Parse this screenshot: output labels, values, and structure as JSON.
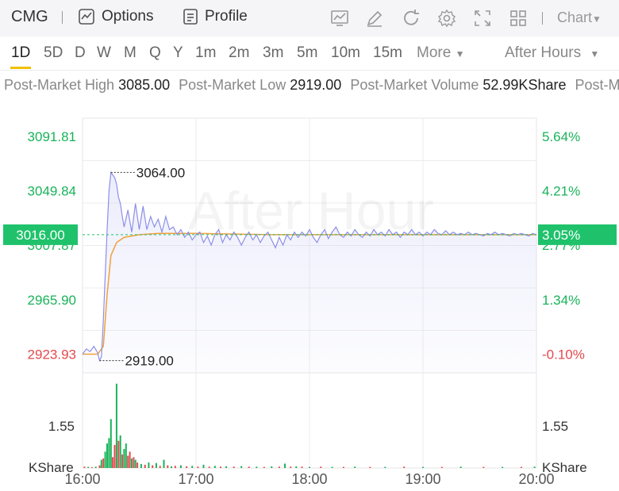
{
  "header": {
    "symbol": "CMG",
    "options_label": "Options",
    "profile_label": "Profile",
    "chart_label": "Chart"
  },
  "periods": [
    "1D",
    "5D",
    "D",
    "W",
    "M",
    "Q",
    "Y",
    "1m",
    "2m",
    "3m",
    "5m",
    "10m",
    "15m"
  ],
  "active_period": "1D",
  "more_label": "More",
  "session_label": "After Hours",
  "stats": [
    {
      "label": "Post-Market High",
      "value": "3085.00"
    },
    {
      "label": "Post-Market Low",
      "value": "2919.00"
    },
    {
      "label": "Post-Market Volume",
      "value": "52.99KShare"
    },
    {
      "label": "Post-Market Turnover",
      "value": ""
    }
  ],
  "colors": {
    "up": "#19b35a",
    "down": "#e5484d",
    "price_line": "#8c8fe8",
    "avg_line": "#f2a03c",
    "badge_bg": "#1fc26b"
  },
  "chart_data": {
    "type": "line",
    "watermark": "After Hour",
    "x_ticks": [
      "16:00",
      "17:00",
      "18:00",
      "19:00",
      "20:00"
    ],
    "x_range": [
      0,
      240
    ],
    "y_range": [
      2909.61,
      3105.78
    ],
    "y_ticks_left": [
      "3091.81",
      "3049.84",
      "3007.87",
      "2965.90",
      "2923.93"
    ],
    "y_ticks_right": [
      "5.64%",
      "4.21%",
      "2.77%",
      "1.34%",
      "-0.10%"
    ],
    "last_price": "3016.00",
    "last_price_pct": "3.05%",
    "max_label": "3064.00",
    "min_label": "2919.00",
    "max_point": {
      "t": 15,
      "v": 3064.0
    },
    "min_point": {
      "t": 9,
      "v": 2919.0
    },
    "price_series": [
      {
        "t": 0,
        "v": 2924
      },
      {
        "t": 2,
        "v": 2928
      },
      {
        "t": 4,
        "v": 2926
      },
      {
        "t": 6,
        "v": 2930
      },
      {
        "t": 8,
        "v": 2925
      },
      {
        "t": 9,
        "v": 2919
      },
      {
        "t": 10,
        "v": 2922
      },
      {
        "t": 11,
        "v": 2950
      },
      {
        "t": 12,
        "v": 2985
      },
      {
        "t": 13,
        "v": 3020
      },
      {
        "t": 14,
        "v": 3050
      },
      {
        "t": 15,
        "v": 3064
      },
      {
        "t": 16,
        "v": 3062
      },
      {
        "t": 17,
        "v": 3060
      },
      {
        "t": 18,
        "v": 3055
      },
      {
        "t": 19,
        "v": 3045
      },
      {
        "t": 20,
        "v": 3040
      },
      {
        "t": 21,
        "v": 3030
      },
      {
        "t": 22,
        "v": 3022
      },
      {
        "t": 24,
        "v": 3035
      },
      {
        "t": 26,
        "v": 3018
      },
      {
        "t": 28,
        "v": 3040
      },
      {
        "t": 30,
        "v": 3020
      },
      {
        "t": 32,
        "v": 3038
      },
      {
        "t": 34,
        "v": 3020
      },
      {
        "t": 36,
        "v": 3030
      },
      {
        "t": 38,
        "v": 3022
      },
      {
        "t": 40,
        "v": 3028
      },
      {
        "t": 42,
        "v": 3018
      },
      {
        "t": 44,
        "v": 3030
      },
      {
        "t": 46,
        "v": 3020
      },
      {
        "t": 48,
        "v": 3022
      },
      {
        "t": 50,
        "v": 3016
      },
      {
        "t": 52,
        "v": 3020
      },
      {
        "t": 54,
        "v": 3014
      },
      {
        "t": 56,
        "v": 3018
      },
      {
        "t": 58,
        "v": 3012
      },
      {
        "t": 60,
        "v": 3016
      },
      {
        "t": 62,
        "v": 3018
      },
      {
        "t": 64,
        "v": 3010
      },
      {
        "t": 66,
        "v": 3015
      },
      {
        "t": 68,
        "v": 3008
      },
      {
        "t": 70,
        "v": 3016
      },
      {
        "t": 72,
        "v": 3020
      },
      {
        "t": 74,
        "v": 3010
      },
      {
        "t": 76,
        "v": 3016
      },
      {
        "t": 78,
        "v": 3012
      },
      {
        "t": 80,
        "v": 3018
      },
      {
        "t": 82,
        "v": 3014
      },
      {
        "t": 84,
        "v": 3008
      },
      {
        "t": 86,
        "v": 3014
      },
      {
        "t": 88,
        "v": 3018
      },
      {
        "t": 90,
        "v": 3012
      },
      {
        "t": 92,
        "v": 3016
      },
      {
        "t": 94,
        "v": 3010
      },
      {
        "t": 96,
        "v": 3015
      },
      {
        "t": 98,
        "v": 3018
      },
      {
        "t": 100,
        "v": 3012
      },
      {
        "t": 102,
        "v": 3006
      },
      {
        "t": 104,
        "v": 3014
      },
      {
        "t": 106,
        "v": 3008
      },
      {
        "t": 108,
        "v": 3016
      },
      {
        "t": 110,
        "v": 3012
      },
      {
        "t": 112,
        "v": 3018
      },
      {
        "t": 114,
        "v": 3014
      },
      {
        "t": 116,
        "v": 3018
      },
      {
        "t": 118,
        "v": 3015
      },
      {
        "t": 120,
        "v": 3020
      },
      {
        "t": 122,
        "v": 3014
      },
      {
        "t": 124,
        "v": 3010
      },
      {
        "t": 126,
        "v": 3016
      },
      {
        "t": 128,
        "v": 3020
      },
      {
        "t": 130,
        "v": 3013
      },
      {
        "t": 132,
        "v": 3018
      },
      {
        "t": 134,
        "v": 3022
      },
      {
        "t": 136,
        "v": 3016
      },
      {
        "t": 138,
        "v": 3014
      },
      {
        "t": 140,
        "v": 3018
      },
      {
        "t": 142,
        "v": 3015
      },
      {
        "t": 144,
        "v": 3020
      },
      {
        "t": 146,
        "v": 3016
      },
      {
        "t": 148,
        "v": 3014
      },
      {
        "t": 150,
        "v": 3018
      },
      {
        "t": 152,
        "v": 3015
      },
      {
        "t": 154,
        "v": 3020
      },
      {
        "t": 156,
        "v": 3016
      },
      {
        "t": 158,
        "v": 3018
      },
      {
        "t": 160,
        "v": 3015
      },
      {
        "t": 162,
        "v": 3020
      },
      {
        "t": 164,
        "v": 3016
      },
      {
        "t": 166,
        "v": 3018
      },
      {
        "t": 168,
        "v": 3014
      },
      {
        "t": 170,
        "v": 3018
      },
      {
        "t": 172,
        "v": 3016
      },
      {
        "t": 174,
        "v": 3020
      },
      {
        "t": 176,
        "v": 3016
      },
      {
        "t": 178,
        "v": 3018
      },
      {
        "t": 180,
        "v": 3015
      },
      {
        "t": 182,
        "v": 3018
      },
      {
        "t": 184,
        "v": 3016
      },
      {
        "t": 186,
        "v": 3020
      },
      {
        "t": 188,
        "v": 3017
      },
      {
        "t": 190,
        "v": 3016
      },
      {
        "t": 192,
        "v": 3019
      },
      {
        "t": 194,
        "v": 3016
      },
      {
        "t": 196,
        "v": 3018
      },
      {
        "t": 198,
        "v": 3016
      },
      {
        "t": 200,
        "v": 3017
      },
      {
        "t": 202,
        "v": 3016
      },
      {
        "t": 204,
        "v": 3018
      },
      {
        "t": 206,
        "v": 3016
      },
      {
        "t": 208,
        "v": 3017
      },
      {
        "t": 210,
        "v": 3016
      },
      {
        "t": 212,
        "v": 3015
      },
      {
        "t": 214,
        "v": 3017
      },
      {
        "t": 216,
        "v": 3016
      },
      {
        "t": 218,
        "v": 3018
      },
      {
        "t": 220,
        "v": 3016
      },
      {
        "t": 222,
        "v": 3017
      },
      {
        "t": 224,
        "v": 3016
      },
      {
        "t": 226,
        "v": 3015
      },
      {
        "t": 228,
        "v": 3017
      },
      {
        "t": 230,
        "v": 3016
      },
      {
        "t": 232,
        "v": 3017
      },
      {
        "t": 234,
        "v": 3016
      },
      {
        "t": 236,
        "v": 3015
      },
      {
        "t": 238,
        "v": 3017
      },
      {
        "t": 240,
        "v": 3016
      }
    ],
    "avg_series": [
      {
        "t": 0,
        "v": 2924
      },
      {
        "t": 8,
        "v": 2924
      },
      {
        "t": 11,
        "v": 2930
      },
      {
        "t": 13,
        "v": 2970
      },
      {
        "t": 15,
        "v": 3000
      },
      {
        "t": 18,
        "v": 3010
      },
      {
        "t": 22,
        "v": 3014
      },
      {
        "t": 30,
        "v": 3016
      },
      {
        "t": 40,
        "v": 3017
      },
      {
        "t": 60,
        "v": 3017
      },
      {
        "t": 100,
        "v": 3016
      },
      {
        "t": 140,
        "v": 3016
      },
      {
        "t": 180,
        "v": 3016
      },
      {
        "t": 240,
        "v": 3016
      }
    ],
    "volume_label_value": "1.55",
    "volume_unit": "KShare",
    "volume_max": 3.5,
    "volume_tick": 1.55,
    "volume": [
      {
        "t": 1,
        "v": 0.05,
        "d": "down"
      },
      {
        "t": 3,
        "v": 0.04,
        "d": "up"
      },
      {
        "t": 5,
        "v": 0.03,
        "d": "down"
      },
      {
        "t": 7,
        "v": 0.05,
        "d": "up"
      },
      {
        "t": 9,
        "v": 0.1,
        "d": "down"
      },
      {
        "t": 10,
        "v": 0.3,
        "d": "up"
      },
      {
        "t": 11,
        "v": 0.35,
        "d": "down"
      },
      {
        "t": 12,
        "v": 0.6,
        "d": "up"
      },
      {
        "t": 13,
        "v": 0.9,
        "d": "up"
      },
      {
        "t": 14,
        "v": 1.1,
        "d": "up"
      },
      {
        "t": 15,
        "v": 1.8,
        "d": "up"
      },
      {
        "t": 16,
        "v": 0.4,
        "d": "down"
      },
      {
        "t": 17,
        "v": 0.85,
        "d": "down"
      },
      {
        "t": 18,
        "v": 3.1,
        "d": "up"
      },
      {
        "t": 19,
        "v": 1.0,
        "d": "down"
      },
      {
        "t": 20,
        "v": 1.2,
        "d": "up"
      },
      {
        "t": 21,
        "v": 0.5,
        "d": "down"
      },
      {
        "t": 22,
        "v": 0.7,
        "d": "up"
      },
      {
        "t": 23,
        "v": 0.9,
        "d": "up"
      },
      {
        "t": 24,
        "v": 0.45,
        "d": "down"
      },
      {
        "t": 25,
        "v": 0.6,
        "d": "down"
      },
      {
        "t": 26,
        "v": 0.35,
        "d": "up"
      },
      {
        "t": 27,
        "v": 0.4,
        "d": "down"
      },
      {
        "t": 28,
        "v": 0.3,
        "d": "up"
      },
      {
        "t": 29,
        "v": 0.2,
        "d": "down"
      },
      {
        "t": 31,
        "v": 0.15,
        "d": "up"
      },
      {
        "t": 33,
        "v": 0.12,
        "d": "down"
      },
      {
        "t": 35,
        "v": 0.2,
        "d": "up"
      },
      {
        "t": 37,
        "v": 0.1,
        "d": "down"
      },
      {
        "t": 39,
        "v": 0.18,
        "d": "up"
      },
      {
        "t": 41,
        "v": 0.08,
        "d": "down"
      },
      {
        "t": 43,
        "v": 0.3,
        "d": "up"
      },
      {
        "t": 45,
        "v": 0.1,
        "d": "down"
      },
      {
        "t": 47,
        "v": 0.06,
        "d": "up"
      },
      {
        "t": 49,
        "v": 0.08,
        "d": "down"
      },
      {
        "t": 52,
        "v": 0.1,
        "d": "up"
      },
      {
        "t": 55,
        "v": 0.06,
        "d": "down"
      },
      {
        "t": 58,
        "v": 0.08,
        "d": "up"
      },
      {
        "t": 61,
        "v": 0.05,
        "d": "down"
      },
      {
        "t": 64,
        "v": 0.12,
        "d": "up"
      },
      {
        "t": 67,
        "v": 0.05,
        "d": "down"
      },
      {
        "t": 70,
        "v": 0.08,
        "d": "up"
      },
      {
        "t": 73,
        "v": 0.05,
        "d": "down"
      },
      {
        "t": 76,
        "v": 0.06,
        "d": "up"
      },
      {
        "t": 80,
        "v": 0.05,
        "d": "down"
      },
      {
        "t": 84,
        "v": 0.07,
        "d": "up"
      },
      {
        "t": 88,
        "v": 0.05,
        "d": "down"
      },
      {
        "t": 92,
        "v": 0.05,
        "d": "up"
      },
      {
        "t": 96,
        "v": 0.04,
        "d": "down"
      },
      {
        "t": 100,
        "v": 0.06,
        "d": "up"
      },
      {
        "t": 104,
        "v": 0.05,
        "d": "down"
      },
      {
        "t": 107,
        "v": 0.16,
        "d": "up"
      },
      {
        "t": 110,
        "v": 0.05,
        "d": "down"
      },
      {
        "t": 113,
        "v": 0.06,
        "d": "up"
      },
      {
        "t": 116,
        "v": 0.05,
        "d": "down"
      },
      {
        "t": 120,
        "v": 0.04,
        "d": "up"
      },
      {
        "t": 126,
        "v": 0.05,
        "d": "down"
      },
      {
        "t": 132,
        "v": 0.04,
        "d": "up"
      },
      {
        "t": 138,
        "v": 0.04,
        "d": "down"
      },
      {
        "t": 144,
        "v": 0.05,
        "d": "up"
      },
      {
        "t": 152,
        "v": 0.04,
        "d": "down"
      },
      {
        "t": 160,
        "v": 0.04,
        "d": "up"
      },
      {
        "t": 170,
        "v": 0.05,
        "d": "down"
      },
      {
        "t": 180,
        "v": 0.04,
        "d": "up"
      },
      {
        "t": 190,
        "v": 0.04,
        "d": "down"
      },
      {
        "t": 200,
        "v": 0.05,
        "d": "up"
      },
      {
        "t": 212,
        "v": 0.04,
        "d": "down"
      },
      {
        "t": 222,
        "v": 0.04,
        "d": "up"
      },
      {
        "t": 232,
        "v": 0.04,
        "d": "down"
      },
      {
        "t": 239,
        "v": 0.05,
        "d": "up"
      }
    ]
  }
}
